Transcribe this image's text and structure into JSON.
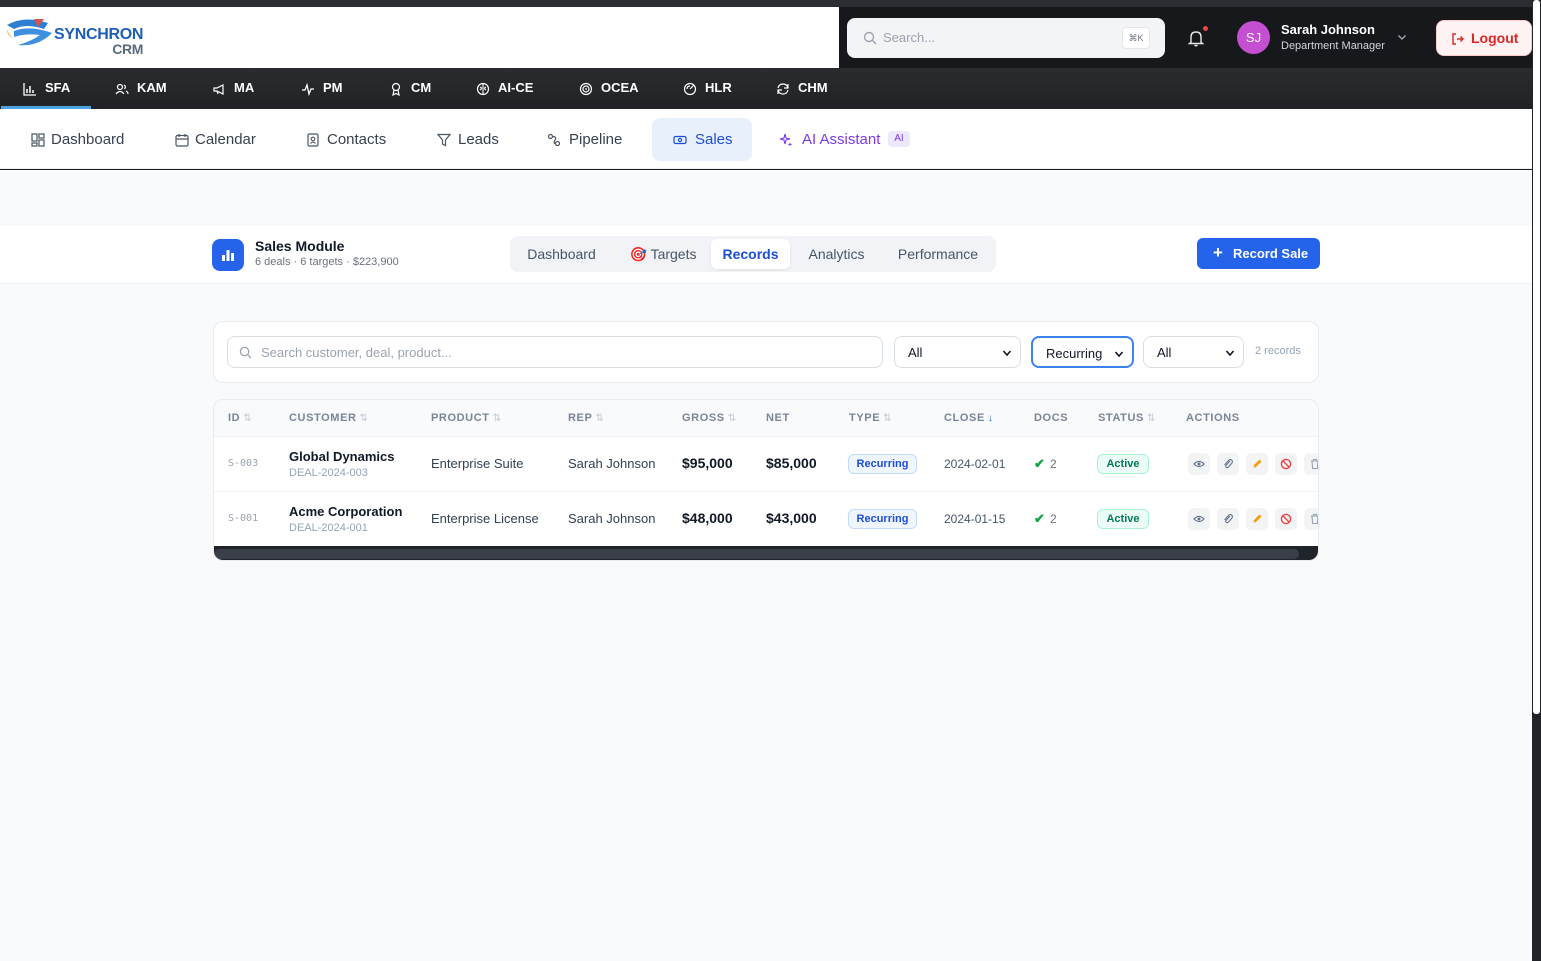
{
  "brand": {
    "name": "SYNCHRON",
    "sub": "CRM"
  },
  "header": {
    "search_placeholder": "Search...",
    "search_shortcut": "⌘K",
    "user": {
      "initials": "SJ",
      "name": "Sarah Johnson",
      "role": "Department Manager"
    },
    "logout_label": "Logout"
  },
  "modules": [
    {
      "label": "SFA",
      "icon": "bar-chart-icon",
      "active": true
    },
    {
      "label": "KAM",
      "icon": "users-icon"
    },
    {
      "label": "MA",
      "icon": "megaphone-icon"
    },
    {
      "label": "PM",
      "icon": "activity-icon"
    },
    {
      "label": "CM",
      "icon": "award-icon"
    },
    {
      "label": "AI-CE",
      "icon": "brain-icon"
    },
    {
      "label": "OCEA",
      "icon": "target-icon"
    },
    {
      "label": "HLR",
      "icon": "radar-icon"
    },
    {
      "label": "CHM",
      "icon": "refresh-icon"
    }
  ],
  "subnav": [
    {
      "label": "Dashboard",
      "icon": "grid-icon"
    },
    {
      "label": "Calendar",
      "icon": "calendar-icon"
    },
    {
      "label": "Contacts",
      "icon": "contact-book-icon"
    },
    {
      "label": "Leads",
      "icon": "filter-icon"
    },
    {
      "label": "Pipeline",
      "icon": "route-icon"
    },
    {
      "label": "Sales",
      "icon": "banknote-icon",
      "active": true
    },
    {
      "label": "AI Assistant",
      "icon": "sparkles-icon",
      "badge": "AI"
    }
  ],
  "module_header": {
    "title": "Sales Module",
    "subtitle": "6 deals · 6 targets · $223,900",
    "tabs": [
      "Dashboard",
      "🎯 Targets",
      "Records",
      "Analytics",
      "Performance"
    ],
    "active_tab": "Records",
    "action_label": "Record Sale"
  },
  "filters": {
    "search_placeholder": "Search customer, deal, product...",
    "select_1": "All",
    "select_2": "Recurring",
    "select_3": "All",
    "count": "2 records"
  },
  "table": {
    "columns": [
      "ID",
      "CUSTOMER",
      "PRODUCT",
      "REP",
      "GROSS",
      "NET",
      "TYPE",
      "CLOSE",
      "DOCS",
      "STATUS",
      "ACTIONS"
    ],
    "rows": [
      {
        "id": "S-003",
        "customer": "Global Dynamics",
        "deal": "DEAL-2024-003",
        "product": "Enterprise Suite",
        "rep": "Sarah Johnson",
        "gross": "$95,000",
        "net": "$85,000",
        "type": "Recurring",
        "close": "2024-02-01",
        "docs_mark": "✔",
        "docs": "2",
        "status": "Active"
      },
      {
        "id": "S-001",
        "customer": "Acme Corporation",
        "deal": "DEAL-2024-001",
        "product": "Enterprise License",
        "rep": "Sarah Johnson",
        "gross": "$48,000",
        "net": "$43,000",
        "type": "Recurring",
        "close": "2024-01-15",
        "docs_mark": "✔",
        "docs": "2",
        "status": "Active"
      }
    ]
  },
  "colors": {
    "primary": "#2563eb",
    "logout": "#dc2626",
    "active_green": "#047857",
    "ai_purple": "#7c3aed"
  }
}
